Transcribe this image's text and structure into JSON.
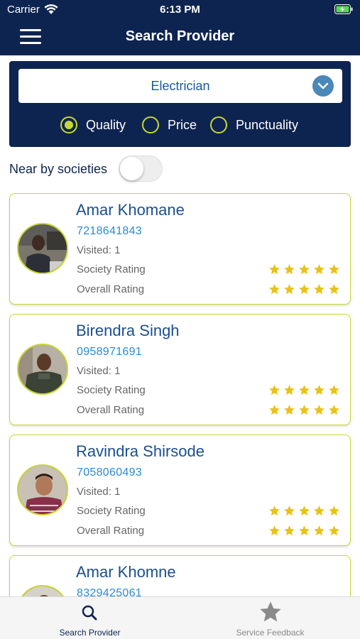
{
  "status_bar": {
    "carrier": "Carrier",
    "time": "6:13 PM"
  },
  "header": {
    "title": "Search Provider",
    "menu_icon": "hamburger-menu-icon"
  },
  "filter": {
    "category": "Electrician",
    "options": [
      {
        "label": "Quality",
        "selected": true
      },
      {
        "label": "Price",
        "selected": false
      },
      {
        "label": "Punctuality",
        "selected": false
      }
    ]
  },
  "nearby": {
    "label": "Near by societies",
    "enabled": false
  },
  "providers": [
    {
      "name": "Amar Khomane",
      "phone": "7218641843",
      "visited": "Visited: 1",
      "society_rating_label": "Society Rating",
      "society_rating": 5,
      "overall_rating_label": "Overall Rating",
      "overall_rating": 5
    },
    {
      "name": "Birendra Singh",
      "phone": "0958971691",
      "visited": "Visited: 1",
      "society_rating_label": "Society Rating",
      "society_rating": 5,
      "overall_rating_label": "Overall Rating",
      "overall_rating": 5
    },
    {
      "name": "Ravindra Shirsode",
      "phone": "7058060493",
      "visited": "Visited: 1",
      "society_rating_label": "Society Rating",
      "society_rating": 5,
      "overall_rating_label": "Overall Rating",
      "overall_rating": 5
    },
    {
      "name": "Amar Khomne",
      "phone": "8329425061"
    }
  ],
  "tabs": [
    {
      "label": "Search Provider",
      "icon": "search-icon",
      "active": true
    },
    {
      "label": "Service Feedback",
      "icon": "star-icon",
      "active": false
    }
  ],
  "colors": {
    "navy": "#0e2450",
    "accent": "#c8d832",
    "link": "#2a8ad8",
    "star": "#e8c21a"
  }
}
